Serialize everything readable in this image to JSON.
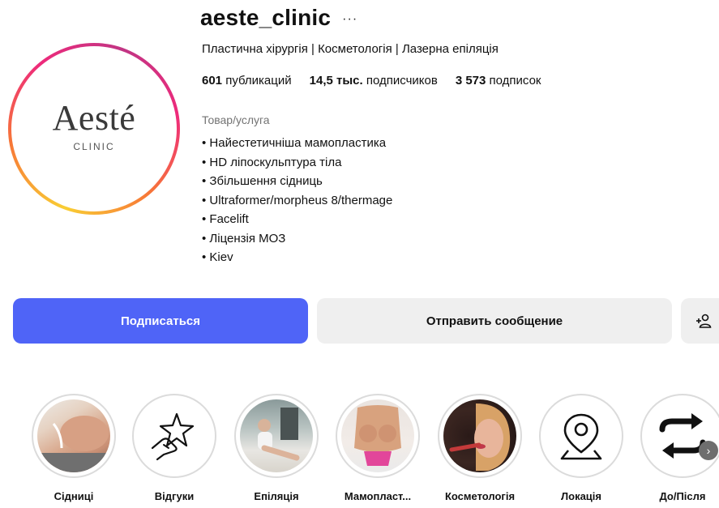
{
  "profile": {
    "username": "aeste_clinic",
    "more": "···",
    "category_line": "Пластична хірургія | Косметологія | Лазерна епіляція",
    "logo": {
      "main": "Aesté",
      "sub": "CLINIC"
    }
  },
  "stats": {
    "posts_value": "601",
    "posts_label": "публикаций",
    "followers_value": "14,5 тыс.",
    "followers_label": "подписчиков",
    "following_value": "3 573",
    "following_label": "подписок"
  },
  "bio": {
    "category": "Товар/услуга",
    "lines": [
      "Найестетичніша мамопластика",
      "HD ліпоскульптура тіла",
      "Збільшення сідниць",
      "Ultraformer/morpheus 8/thermage",
      "Facelift",
      "Ліцензія МОЗ",
      "Kiev"
    ]
  },
  "actions": {
    "follow_label": "Подписаться",
    "message_label": "Отправить сообщение",
    "add_user_icon": "add-user-icon"
  },
  "highlights": [
    {
      "label": "Сідниці",
      "icon": "photo"
    },
    {
      "label": "Відгуки",
      "icon": "star-hand-icon"
    },
    {
      "label": "Епіляція",
      "icon": "photo"
    },
    {
      "label": "Мамопласт...",
      "icon": "photo"
    },
    {
      "label": "Косметологія",
      "icon": "photo"
    },
    {
      "label": "Локація",
      "icon": "location-pin-icon"
    },
    {
      "label": "До/Після",
      "icon": "swap-arrows-icon"
    }
  ],
  "colors": {
    "accent": "#4f64f7",
    "secondary_button": "#efefef",
    "muted_text": "#737373"
  }
}
